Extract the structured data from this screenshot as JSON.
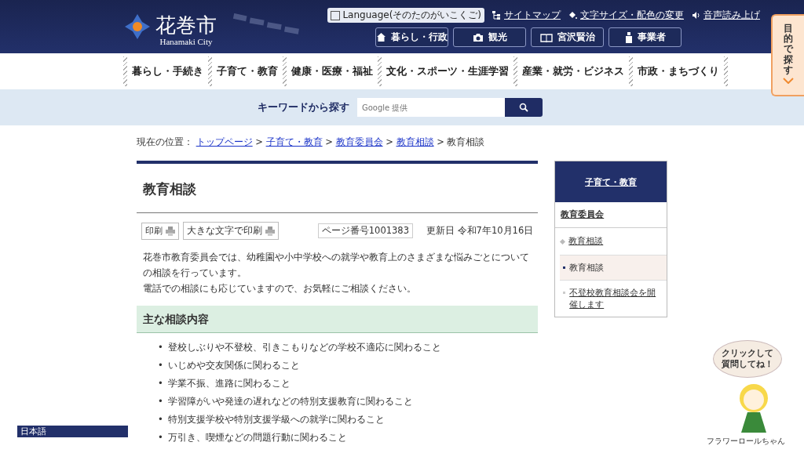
{
  "header": {
    "logo_title": "花巻市",
    "logo_subtitle": "Hanamaki City",
    "language_button": "Language(そのたのがいこくご)",
    "utility_links": [
      "サイトマップ",
      "文字サイズ・配色の変更",
      "音声読み上げ"
    ],
    "audience_buttons": [
      "暮らし・行政",
      "観光",
      "宮沢賢治",
      "事業者"
    ]
  },
  "global_nav": [
    "暮らし・手続き",
    "子育て・教育",
    "健康・医療・福祉",
    "文化・スポーツ・生涯学習",
    "産業・就労・ビジネス",
    "市政・まちづくり"
  ],
  "search": {
    "label": "キーワードから探す",
    "placeholder": "Google 提供"
  },
  "side_tab": {
    "label": "目的で探す"
  },
  "breadcrumb": {
    "label": "現在の位置：",
    "links": [
      "トップページ",
      "子育て・教育",
      "教育委員会",
      "教育相談"
    ],
    "separators": [
      ">",
      ">",
      ">",
      ">"
    ],
    "current": "教育相談"
  },
  "page": {
    "title": "教育相談",
    "print_buttons": [
      "印刷",
      "大きな文字で印刷"
    ],
    "page_number": "ページ番号1001383",
    "updated": "更新日 令和7年10月16日",
    "intro": [
      "花巻市教育委員会では、幼稚園や小中学校への就学や教育上のさまざまな悩みごとについての相談を行っています。",
      "電話での相談にも応じていますので、お気軽にご相談ください。"
    ],
    "section_heading": "主な相談内容",
    "items": [
      {
        "marker": "•",
        "text": "登校しぶりや不登校、引きこもりなどの学校不適応に関わること"
      },
      {
        "marker": "•",
        "text": "いじめや交友関係に関わること"
      },
      {
        "marker": "•",
        "text": "学業不振、進路に関わること"
      },
      {
        "marker": "•",
        "text": "学習障がいや発達の遅れなどの特別支援教育に関わること"
      },
      {
        "marker": "•",
        "text": "特別支援学校や特別支援学級への就学に関わること"
      },
      {
        "marker": "•",
        "text": "万引き、喫煙などの問題行動に関わること"
      }
    ]
  },
  "side_menu": {
    "heading": "子育て・教育",
    "items": [
      {
        "label": "教育委員会",
        "children": [
          {
            "label": "教育相談",
            "children": [
              {
                "label": "教育相談",
                "selected": true
              },
              {
                "label": "不登校教育相談会を開催します",
                "selected": false
              }
            ]
          }
        ]
      }
    ]
  },
  "language_bar": "日本語",
  "chat_widget": {
    "bubble": "クリックして質問してね！",
    "caption": "フラワーロールちゃん"
  }
}
